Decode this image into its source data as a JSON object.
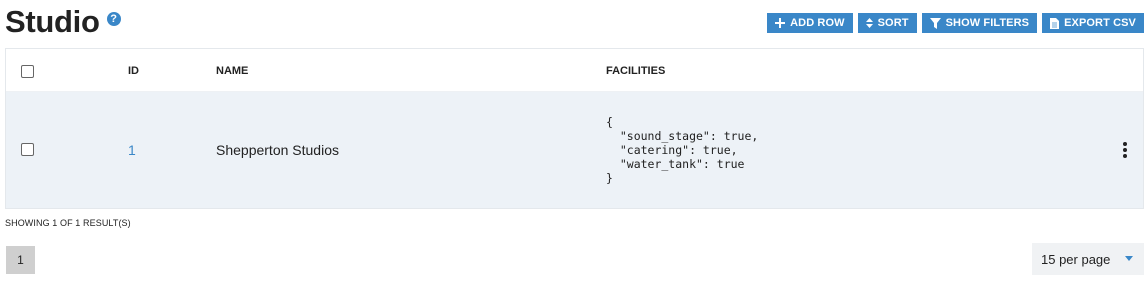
{
  "page": {
    "title": "Studio",
    "help_symbol": "?"
  },
  "toolbar": {
    "add_row": "ADD ROW",
    "sort": "SORT",
    "show_filters": "SHOW FILTERS",
    "export_csv": "EXPORT CSV"
  },
  "table": {
    "columns": {
      "id": "ID",
      "name": "NAME",
      "facilities": "FACILITIES"
    },
    "rows": [
      {
        "id": "1",
        "name": "Shepperton Studios",
        "facilities": "{\n  \"sound_stage\": true,\n  \"catering\": true,\n  \"water_tank\": true\n}"
      }
    ]
  },
  "footer": {
    "showing": "SHOWING 1 OF 1 RESULT(S)",
    "current_page": "1",
    "per_page": "15 per page"
  },
  "colors": {
    "accent": "#3a87c8",
    "row_bg": "#edf2f7",
    "pager_bg": "#cfcfcf"
  },
  "icons": {
    "help": "help-circle-icon",
    "add": "plus-icon",
    "sort": "sort-icon",
    "filter": "filter-icon",
    "export": "file-icon",
    "more": "kebab-icon"
  }
}
